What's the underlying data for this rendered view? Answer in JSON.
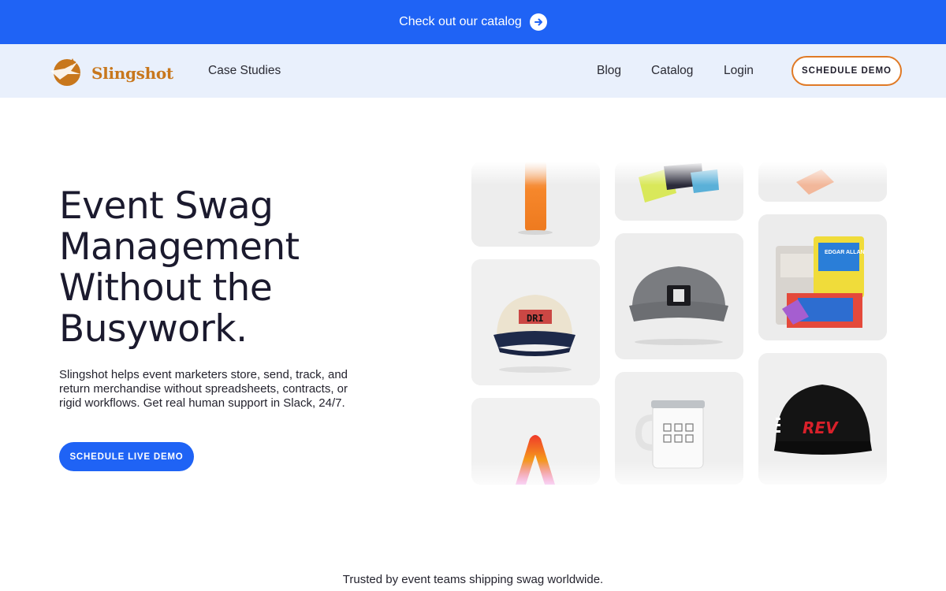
{
  "announcement": {
    "text": "Check out our catalog"
  },
  "nav": {
    "logo_text": "Slingshot",
    "links": {
      "case_studies": "Case Studies",
      "blog": "Blog",
      "catalog": "Catalog",
      "login": "Login"
    },
    "cta": "SCHEDULE DEMO"
  },
  "hero": {
    "title_lines": [
      "Event Swag",
      "Management",
      "Without the",
      "Busywork."
    ],
    "description": "Slingshot helps event marketers store, send, track, and return merchandise without spreadsheets, contracts, or rigid workflows. Get real human support in Slack, 24/7.",
    "cta": "SCHEDULE LIVE DEMO"
  },
  "products": {
    "cap_beige_text": "DRI",
    "cap_black_text": "REV",
    "socks_label": "EDGAR ALLAN"
  },
  "footer": {
    "trusted": "Trusted by event teams shipping swag worldwide."
  },
  "colors": {
    "primary_blue": "#1f63f5",
    "brand_orange": "#c8771c",
    "nav_bg": "#e9f0fc"
  }
}
